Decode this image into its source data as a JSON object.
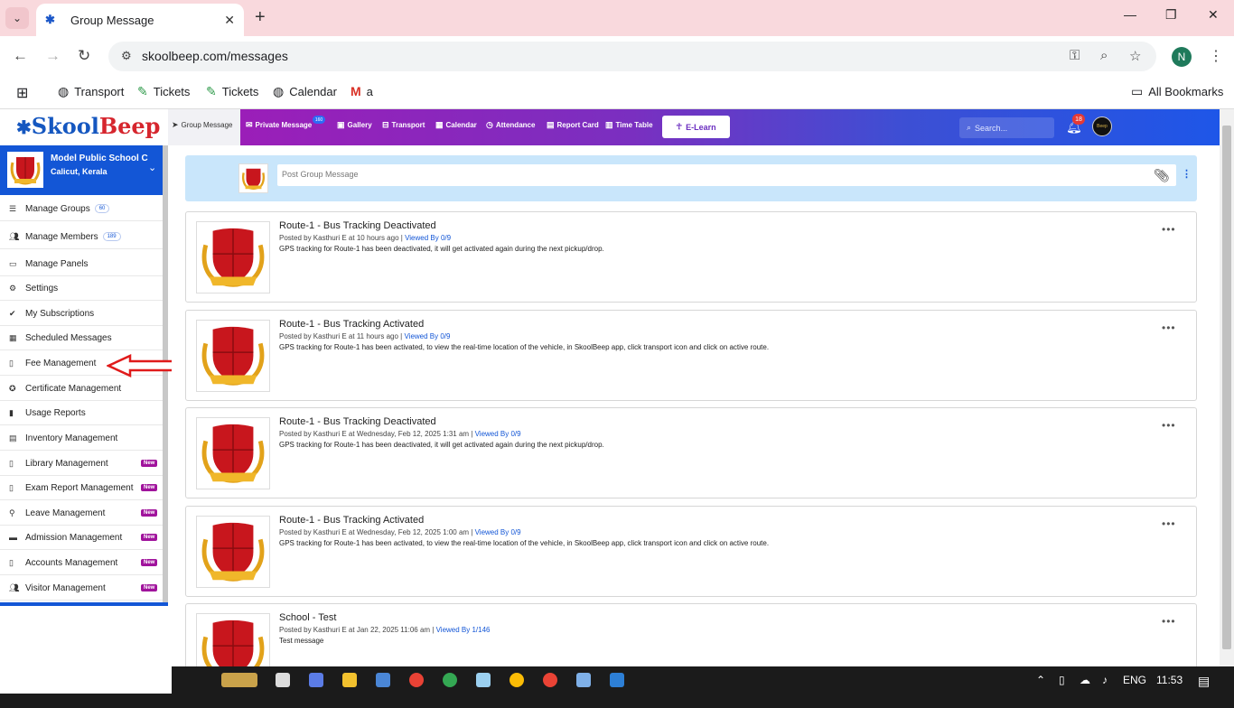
{
  "browser": {
    "tab_title": "Group Message",
    "url": "skoolbeep.com/messages",
    "profile_initial": "N",
    "bookmarks": [
      "Transport",
      "Tickets",
      "Tickets",
      "Calendar",
      "a"
    ],
    "all_bookmarks": "All Bookmarks"
  },
  "header": {
    "logo_skool": "Skool",
    "logo_beep": "Beep",
    "nav": [
      {
        "label": "Group Message",
        "icon": "send-icon"
      },
      {
        "label": "Private Message",
        "icon": "mail-icon"
      },
      {
        "label": "Gallery",
        "icon": "image-icon"
      },
      {
        "label": "Transport",
        "icon": "bus-icon"
      },
      {
        "label": "Calendar",
        "icon": "calendar-icon"
      },
      {
        "label": "Attendance",
        "icon": "clock-icon"
      },
      {
        "label": "Report Card",
        "icon": "file-icon"
      },
      {
        "label": "Time Table",
        "icon": "table-icon"
      }
    ],
    "private_badge": "160",
    "elearn": "E-Learn",
    "search_placeholder": "Search...",
    "notif_count": "18",
    "avatar_text": "Beep"
  },
  "sidebar": {
    "school_name": "Model Public School C",
    "school_location": "Calicut, Kerala",
    "items": [
      {
        "label": "Manage Groups",
        "count": "60"
      },
      {
        "label": "Manage Members",
        "count": "189"
      },
      {
        "label": "Manage Panels"
      },
      {
        "label": "Settings"
      },
      {
        "label": "My Subscriptions"
      },
      {
        "label": "Scheduled Messages"
      },
      {
        "label": "Fee Management"
      },
      {
        "label": "Certificate Management"
      },
      {
        "label": "Usage Reports"
      },
      {
        "label": "Inventory Management"
      },
      {
        "label": "Library Management",
        "badge": "New"
      },
      {
        "label": "Exam Report Management",
        "badge": "New"
      },
      {
        "label": "Leave Management",
        "badge": "New"
      },
      {
        "label": "Admission Management",
        "badge": "New"
      },
      {
        "label": "Accounts Management",
        "badge": "New"
      },
      {
        "label": "Visitor Management",
        "badge": "New"
      }
    ]
  },
  "composer": {
    "placeholder": "Post Group Message"
  },
  "posts": [
    {
      "title": "Route-1 - Bus Tracking Deactivated",
      "meta": "Posted by Kasthuri E at 10 hours ago",
      "viewed": "Viewed By 0/9",
      "message": "GPS tracking for Route-1 has been deactivated, it will get activated again during the next pickup/drop."
    },
    {
      "title": "Route-1 - Bus Tracking Activated",
      "meta": "Posted by Kasthuri E at 11 hours ago",
      "viewed": "Viewed By 0/9",
      "message": "GPS tracking for Route-1 has been activated, to view the real-time location of the vehicle, in SkoolBeep app, click transport icon and click on active route."
    },
    {
      "title": "Route-1 - Bus Tracking Deactivated",
      "meta": "Posted by Kasthuri E at Wednesday, Feb 12, 2025 1:31 am",
      "viewed": "Viewed By 0/9",
      "message": "GPS tracking for Route-1 has been deactivated, it will get activated again during the next pickup/drop."
    },
    {
      "title": "Route-1 - Bus Tracking Activated",
      "meta": "Posted by Kasthuri E at Wednesday, Feb 12, 2025 1:00 am",
      "viewed": "Viewed By 0/9",
      "message": "GPS tracking for Route-1 has been activated, to view the real-time location of the vehicle, in SkoolBeep app, click transport icon and click on active route."
    },
    {
      "title": "School - Test",
      "meta": "Posted by Kasthuri E at Jan 22, 2025 11:06 am",
      "viewed": "Viewed By 1/146",
      "message": "Test message"
    }
  ],
  "taskbar": {
    "language": "ENG",
    "time": "11:53"
  }
}
